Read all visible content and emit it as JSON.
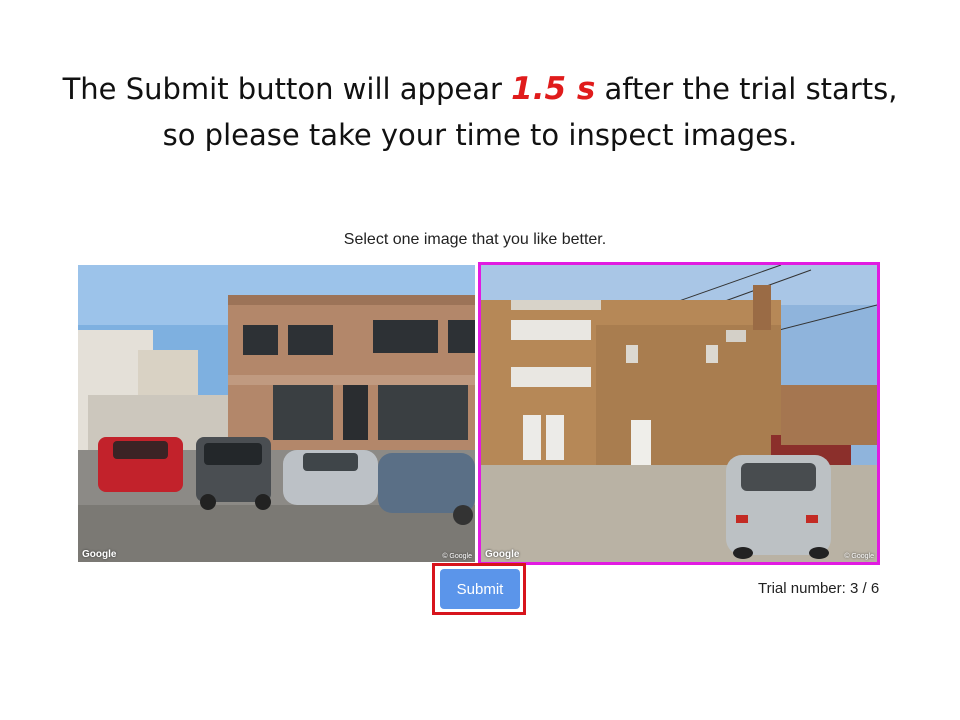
{
  "headline": {
    "part1": "The Submit button will appear ",
    "highlight": "1.5 s",
    "part2": " after the trial starts, so please take your time to inspect images."
  },
  "instruction": "Select one image that you like better.",
  "images": [
    {
      "watermark": "Google",
      "credit": "© Google",
      "selected": false
    },
    {
      "watermark": "Google",
      "credit": "© Google",
      "selected": true
    }
  ],
  "submit_label": "Submit",
  "trial": {
    "label": "Trial number:",
    "current": "3",
    "total": "6"
  },
  "colors": {
    "highlight_text": "#e01b1b",
    "selected_border": "#e11be1",
    "submit_highlight_border": "#d7141c",
    "submit_button": "#5b95ea"
  }
}
